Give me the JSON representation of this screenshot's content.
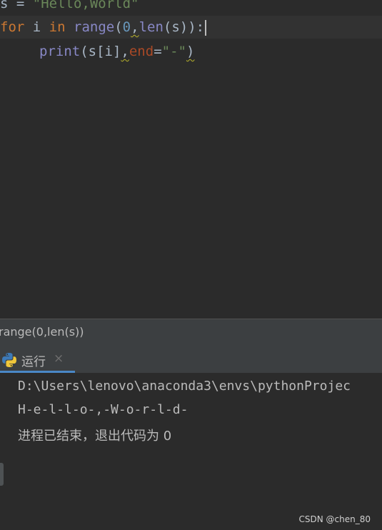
{
  "editor": {
    "lines": [
      {
        "tokens": [
          "s",
          " = ",
          "\"Hello,World\""
        ]
      },
      {
        "tokens": [
          "for",
          " i ",
          "in",
          " ",
          "range",
          "(",
          "0",
          ",",
          "len",
          "(s)):"
        ]
      },
      {
        "tokens": [
          "print",
          "(s[i]",
          ",",
          "end",
          "=",
          "\"-\"",
          ")"
        ]
      }
    ]
  },
  "breadcrumb": {
    "text": "range(0,len(s))"
  },
  "run_panel": {
    "tab_label": "运行",
    "close_glyph": "×"
  },
  "console": {
    "lines": [
      "D:\\Users\\lenovo\\anaconda3\\envs\\pythonProjec",
      "H-e-l-l-o-,-W-o-r-l-d-",
      "进程已结束，退出代码为 0"
    ]
  },
  "watermark": "CSDN @chen_80",
  "colors": {
    "background": "#2b2b2b",
    "keyword": "#cc7832",
    "string": "#6a8759",
    "number": "#6897bb",
    "builtin": "#8888c6",
    "param": "#aa4926",
    "accent": "#4a88c7"
  }
}
